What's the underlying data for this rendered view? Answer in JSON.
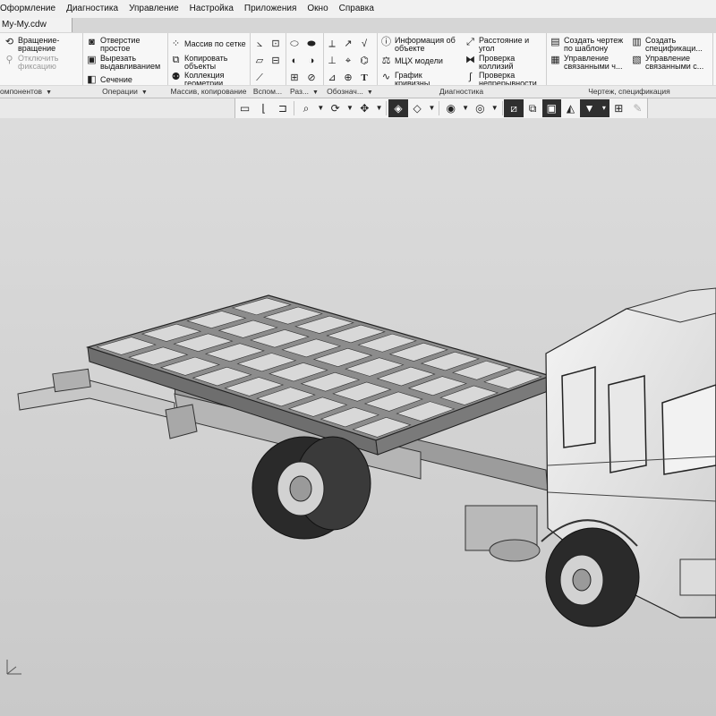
{
  "menu": [
    "Оформление",
    "Диагностика",
    "Управление",
    "Настройка",
    "Приложения",
    "Окно",
    "Справка"
  ],
  "document_tab": "My-My.cdw",
  "groups": {
    "components": {
      "label": "омпонентов",
      "rotate_line1": "Вращение-",
      "rotate_line2": "вращение",
      "unfix_line1": "Отключить",
      "unfix_line2": "фиксацию"
    },
    "operations": {
      "label": "Операции",
      "hole_line1": "Отверстие",
      "hole_line2": "простое",
      "cut_line1": "Вырезать",
      "cut_line2": "выдавливанием",
      "section": "Сечение"
    },
    "array": {
      "label": "Массив, копирование",
      "grid_array": "Массив по сетке",
      "copy_line1": "Копировать",
      "copy_line2": "объекты",
      "collection_line1": "Коллекция",
      "collection_line2": "геометрии"
    },
    "aux_label": "Вспом...",
    "sections_label": "Раз...",
    "marks_label": "Обознач...",
    "diagnostics": {
      "label": "Диагностика",
      "info_line1": "Информация об",
      "info_line2": "объекте",
      "mass": "МЦХ модели",
      "curvature_line1": "График",
      "curvature_line2": "кривизны",
      "distance_line1": "Расстояние и",
      "distance_line2": "угол",
      "collisions_line1": "Проверка",
      "collisions_line2": "коллизий",
      "continuity_line1": "Проверка",
      "continuity_line2": "непрерывности"
    },
    "drawing": {
      "label": "Чертеж, спецификация",
      "create_drawing_line1": "Создать чертеж",
      "create_drawing_line2": "по шаблону",
      "manage_linked_line1": "Управление",
      "manage_linked_line2": "связанными ч...",
      "create_spec_line1": "Создать",
      "create_spec_line2": "спецификаци...",
      "manage_spec_line1": "Управление",
      "manage_spec_line2": "связанными с..."
    }
  },
  "icons": {
    "view_toolbar": [
      "sketch-icon",
      "corner-icon",
      "zoom-icon",
      "rotate-view-icon",
      "pan-icon",
      "cube-view-icon",
      "orientation-icon",
      "visibility-icon",
      "display-mode-icon",
      "section-view-icon",
      "layers-icon",
      "hide-icon",
      "render-icon",
      "filter-icon",
      "properties-icon",
      "pencil-icon"
    ]
  },
  "colors": {
    "ribbon_bg": "#f7f7f7",
    "viewport_top": "#dcdcdc",
    "viewport_bottom": "#c9c9c9"
  }
}
